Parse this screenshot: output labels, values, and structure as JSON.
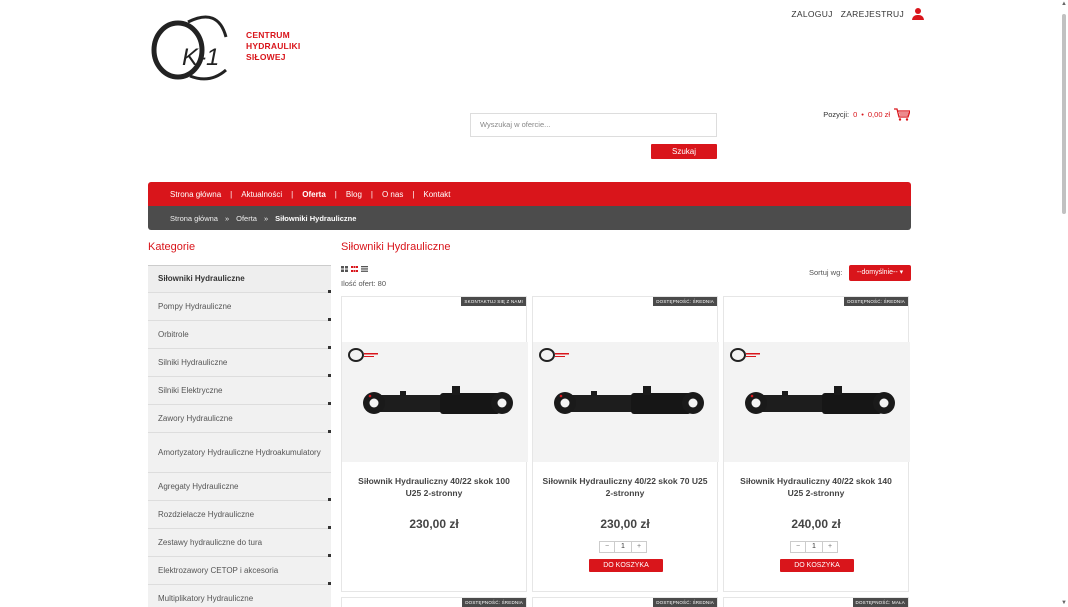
{
  "header": {
    "login": "ZALOGUJ",
    "register": "ZAREJESTRUJ",
    "logo_text": [
      "CENTRUM",
      "HYDRAULIKI",
      "SIŁOWEJ"
    ],
    "logo_mark": "K-1"
  },
  "search": {
    "placeholder": "Wyszukaj w ofercie...",
    "button": "Szukaj"
  },
  "cart": {
    "label": "Pozycji:",
    "count": "0",
    "sep": "•",
    "total": "0,00 zł"
  },
  "nav": {
    "items": [
      "Strona główna",
      "Aktualności",
      "Oferta",
      "Blog",
      "O nas",
      "Kontakt"
    ],
    "separator": "|",
    "active": "Oferta"
  },
  "breadcrumb": {
    "items": [
      "Strona główna",
      "Oferta",
      "Siłowniki Hydrauliczne"
    ],
    "separator": "»"
  },
  "sidebar": {
    "title": "Kategorie",
    "items": [
      {
        "label": "Siłowniki Hydrauliczne"
      },
      {
        "label": "Pompy Hydrauliczne"
      },
      {
        "label": "Orbitrole"
      },
      {
        "label": "Silniki Hydrauliczne"
      },
      {
        "label": "Silniki Elektryczne"
      },
      {
        "label": "Zawory Hydrauliczne"
      },
      {
        "label": "Amortyzatory Hydrauliczne Hydroakumulatory"
      },
      {
        "label": "Agregaty Hydrauliczne"
      },
      {
        "label": "Rozdzielacze Hydrauliczne"
      },
      {
        "label": "Zestawy hydrauliczne do tura"
      },
      {
        "label": "Elektrozawory CETOP i akcesoria"
      },
      {
        "label": "Multiplikatory Hydrauliczne"
      }
    ]
  },
  "main": {
    "title": "Siłowniki Hydrauliczne",
    "count": "Ilość ofert: 80",
    "sort_label": "Sortuj wg:",
    "sort_value": "--domyślnie--",
    "products": [
      {
        "badge": "SKONTAKTUJ SIĘ Z NAMI",
        "name": "Siłownik Hydrauliczny 40/22 skok 100 U25 2-stronny",
        "price": "230,00 zł",
        "buy": false
      },
      {
        "badge": "DOSTĘPNOŚĆ: ŚREDNIA",
        "name": "Siłownik Hydrauliczny 40/22 skok 70 U25 2-stronny",
        "price": "230,00 zł",
        "buy": true
      },
      {
        "badge": "DOSTĘPNOŚĆ: ŚREDNIA",
        "name": "Siłownik Hydrauliczny 40/22 skok 140 U25 2-stronny",
        "price": "240,00 zł",
        "buy": true
      }
    ],
    "qty": {
      "minus": "−",
      "value": "1",
      "plus": "+"
    },
    "buy_label": "DO KOSZYKA",
    "next_badges": [
      "DOSTĘPNOŚĆ: ŚREDNIA",
      "DOSTĘPNOŚĆ: ŚREDNIA",
      "DOSTĘPNOŚĆ: MAŁA"
    ]
  },
  "colors": {
    "accent": "#d9151b",
    "breadcrumb_bg": "#4c4c4c"
  }
}
